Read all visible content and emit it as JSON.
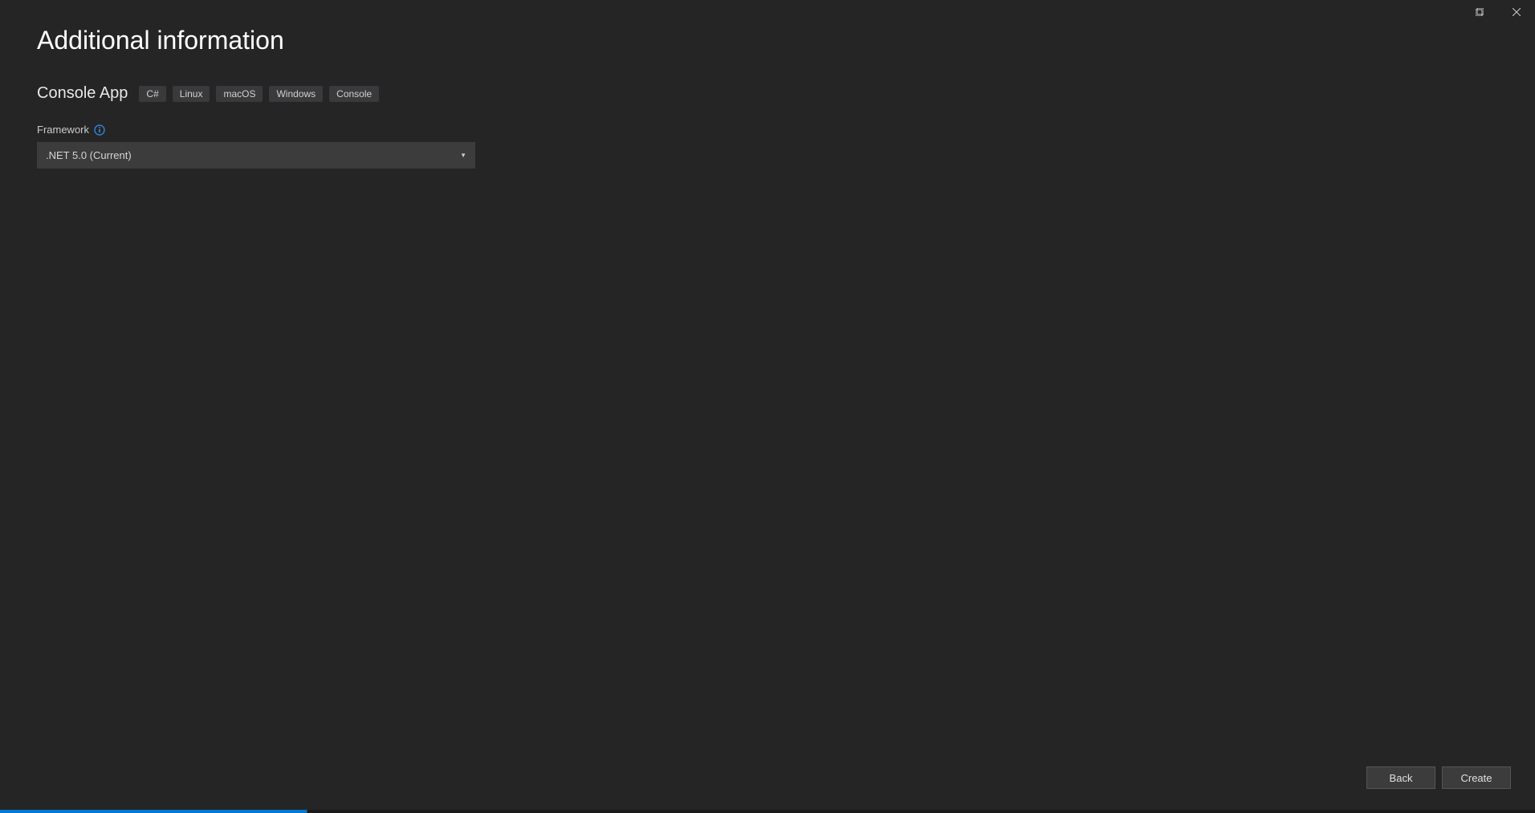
{
  "page": {
    "title": "Additional information",
    "subtitle": "Console App"
  },
  "tags": [
    "C#",
    "Linux",
    "macOS",
    "Windows",
    "Console"
  ],
  "framework": {
    "label": "Framework",
    "selected": ".NET 5.0 (Current)"
  },
  "buttons": {
    "back": "Back",
    "create": "Create"
  }
}
